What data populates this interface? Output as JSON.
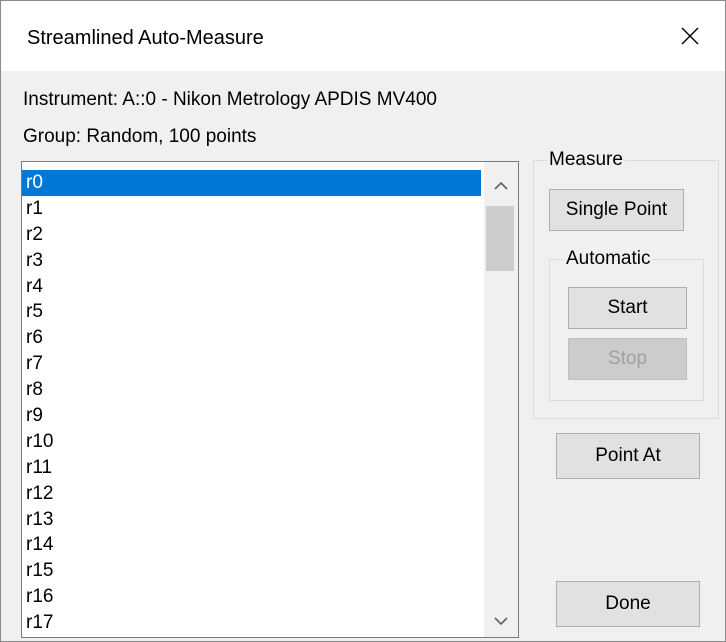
{
  "window": {
    "title": "Streamlined Auto-Measure",
    "close_icon": "close-icon"
  },
  "info": {
    "instrument": "Instrument: A::0 - Nikon Metrology APDIS MV400",
    "group": "Group: Random, 100 points"
  },
  "points_list": {
    "selected": "r0",
    "items": [
      "r0",
      "r1",
      "r2",
      "r3",
      "r4",
      "r5",
      "r6",
      "r7",
      "r8",
      "r9",
      "r10",
      "r11",
      "r12",
      "r13",
      "r14",
      "r15",
      "r16",
      "r17"
    ]
  },
  "measure": {
    "label": "Measure",
    "single_point_label": "Single Point",
    "automatic": {
      "label": "Automatic",
      "start_label": "Start",
      "stop_label": "Stop"
    }
  },
  "point_at_label": "Point At",
  "done_label": "Done",
  "colors": {
    "selection": "#0078d7",
    "background": "#f0f0f0"
  }
}
